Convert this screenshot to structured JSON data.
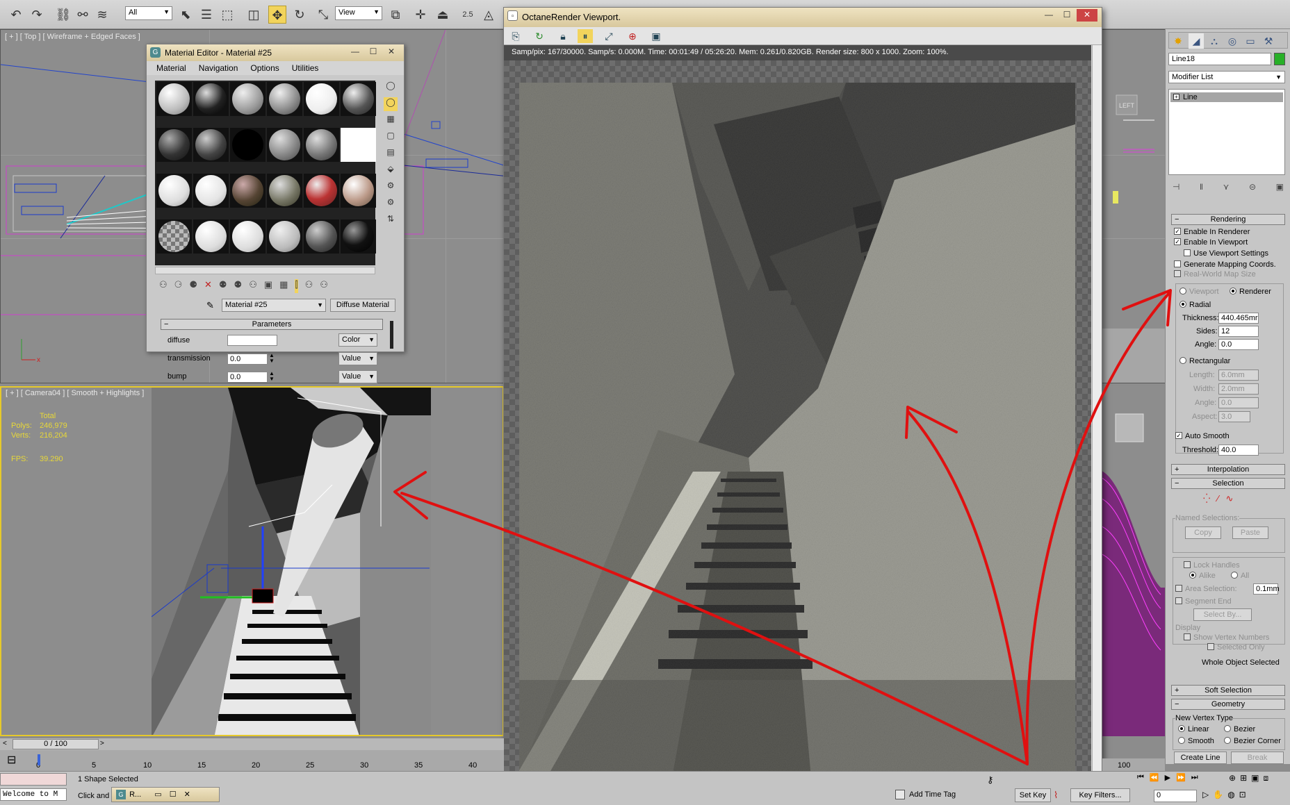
{
  "toolbar": {
    "selection_filter": "All",
    "ref_coord": "View",
    "snap_label": "2.5"
  },
  "viewports": {
    "top_label": "[ + ] [ Top ] [ Wireframe + Edged Faces ]",
    "camera_label": "[ + ] [ Camera04 ] [ Smooth + Highlights ]",
    "stats": {
      "total_header": "Total",
      "polys_label": "Polys:",
      "polys_value": "246,979",
      "verts_label": "Verts:",
      "verts_value": "216,204",
      "fps_label": "FPS:",
      "fps_value": "39.290"
    },
    "viewcube_label": "LEFT"
  },
  "material_editor": {
    "title": "Material Editor - Material #25",
    "menus": [
      "Material",
      "Navigation",
      "Options",
      "Utilities"
    ],
    "material_name": "Material #25",
    "material_type": "Diffuse Material",
    "parameters_title": "Parameters",
    "params": [
      {
        "label": "diffuse",
        "value": "",
        "mode": "Color"
      },
      {
        "label": "transmission",
        "value": "0.0",
        "mode": "Value"
      },
      {
        "label": "bump",
        "value": "0.0",
        "mode": "Value"
      }
    ]
  },
  "octane": {
    "title": "OctaneRender Viewport.",
    "status": "Samp/pix: 167/30000.   Samp/s: 0.000M.   Time: 00:01:49 / 05:26:20.   Mem: 0.261/0.820GB.   Render size: 800 x 1000.   Zoom: 100%."
  },
  "command_panel": {
    "object_name": "Line18",
    "object_color": "#28b028",
    "modifier_list": "Modifier List",
    "stack_item": "Line",
    "rendering": {
      "title": "Rendering",
      "enable_renderer": "Enable In Renderer",
      "enable_viewport": "Enable In Viewport",
      "use_viewport_settings": "Use Viewport Settings",
      "generate_mapping": "Generate Mapping Coords.",
      "real_world": "Real-World Map Size",
      "viewport": "Viewport",
      "renderer": "Renderer",
      "radial": "Radial",
      "thickness_label": "Thickness:",
      "thickness_value": "440.465mr",
      "sides_label": "Sides:",
      "sides_value": "12",
      "angle_label": "Angle:",
      "angle_value": "0.0",
      "rectangular": "Rectangular",
      "length_label": "Length:",
      "length_value": "6.0mm",
      "width_label": "Width:",
      "width_value": "2.0mm",
      "rect_angle_label": "Angle:",
      "rect_angle_value": "0.0",
      "aspect_label": "Aspect:",
      "aspect_value": "3.0",
      "auto_smooth": "Auto Smooth",
      "threshold_label": "Threshold:",
      "threshold_value": "40.0"
    },
    "interpolation_title": "Interpolation",
    "selection": {
      "title": "Selection",
      "named_selections": "Named Selections:",
      "copy": "Copy",
      "paste": "Paste",
      "lock_handles": "Lock Handles",
      "alike": "Alike",
      "all": "All",
      "area_selection": "Area Selection:",
      "area_value": "0.1mm",
      "segment_end": "Segment End",
      "select_by": "Select By...",
      "display": "Display",
      "show_vertex_numbers": "Show Vertex Numbers",
      "selected_only": "Selected Only",
      "whole_object": "Whole Object Selected"
    },
    "soft_selection_title": "Soft Selection",
    "geometry": {
      "title": "Geometry",
      "new_vertex_type": "New Vertex Type",
      "linear": "Linear",
      "bezier": "Bezier",
      "smooth": "Smooth",
      "bezier_corner": "Bezier Corner",
      "create_line": "Create Line",
      "break": "Break"
    }
  },
  "timeline": {
    "frame": "0 / 100",
    "ticks": [
      "0",
      "5",
      "10",
      "15",
      "20",
      "25",
      "30",
      "35",
      "40"
    ],
    "right_tick": "100"
  },
  "status": {
    "maxscript": "Welcome to M",
    "selection": "1 Shape Selected",
    "prompt": "Click and d",
    "taskbar_label": "R...",
    "add_time_tag": "Add Time Tag",
    "set_key": "Set Key",
    "key_filters": "Key Filters...",
    "frame_field": "0"
  }
}
